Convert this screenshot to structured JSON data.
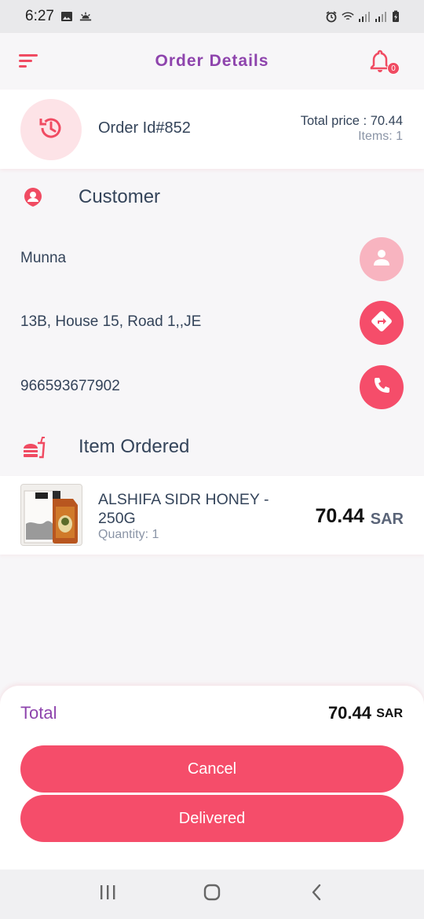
{
  "status_bar": {
    "time": "6:27",
    "icons": [
      "image-icon",
      "weather-icon",
      "alarm-icon",
      "wifi-icon",
      "signal-icon",
      "signal-icon",
      "battery-icon"
    ]
  },
  "app_bar": {
    "title": "Order Details",
    "menu_icon": "menu-icon",
    "notification_icon": "bell-icon",
    "notification_count": "0"
  },
  "order": {
    "id_label": "Order Id#852",
    "total_price_label": "Total price : 70.44",
    "items_label": "Items: 1",
    "status_icon": "history-icon"
  },
  "customer_section": {
    "title": "Customer",
    "icon": "user-pin-icon",
    "name": "Munna",
    "address": "13B, House 15, Road 1,,JE",
    "phone": "966593677902"
  },
  "items_section": {
    "title": "Item Ordered",
    "icon": "fastfood-icon",
    "items": [
      {
        "name": "ALSHIFA SIDR HONEY - 250G",
        "quantity": "Quantity: 1",
        "price": "70.44",
        "currency": "SAR"
      }
    ]
  },
  "summary": {
    "total_label": "Total",
    "total_value": "70.44",
    "currency": "SAR",
    "cancel_label": "Cancel",
    "delivered_label": "Delivered"
  },
  "colors": {
    "accent": "#f54d6a",
    "title_purple": "#8e44ad",
    "text_dark": "#34445a",
    "soft_pink": "#fde3e7"
  }
}
